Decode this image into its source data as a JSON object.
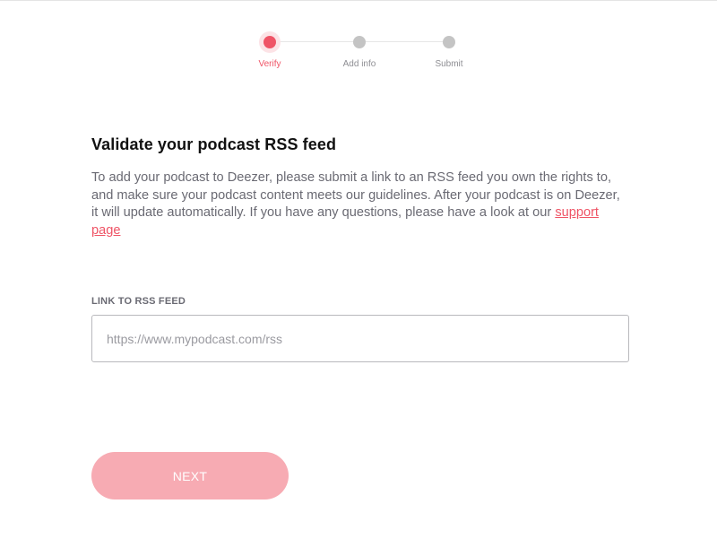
{
  "stepper": {
    "steps": [
      {
        "label": "Verify",
        "active": true
      },
      {
        "label": "Add info",
        "active": false
      },
      {
        "label": "Submit",
        "active": false
      }
    ]
  },
  "main": {
    "title": "Validate your podcast RSS feed",
    "description": "To add your podcast to Deezer, please submit a link to an RSS feed you own the rights to, and make sure your podcast content meets our guidelines. After your podcast is on Deezer, it will update automatically. If you have any questions, please have a look at our ",
    "support_link": "support page"
  },
  "form": {
    "rss_label": "LINK TO RSS FEED",
    "rss_placeholder": "https://www.mypodcast.com/rss",
    "rss_value": "",
    "next_label": "NEXT"
  },
  "colors": {
    "accent": "#ef5466",
    "accent_light": "#f7abb3",
    "inactive_dot": "#c4c4c4"
  }
}
